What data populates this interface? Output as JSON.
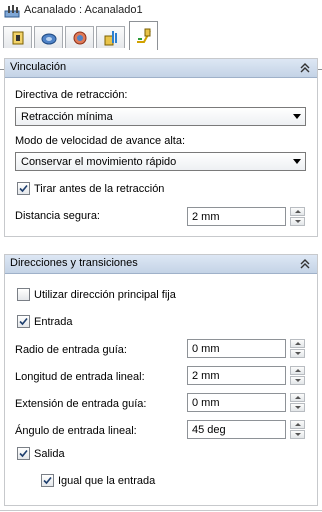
{
  "window": {
    "title": "Acanalado : Acanalado1"
  },
  "tabs": [
    {
      "icon": "strategy-tab-icon",
      "active": false
    },
    {
      "icon": "tool-tab-icon",
      "active": false
    },
    {
      "icon": "stock-tab-icon",
      "active": false
    },
    {
      "icon": "passes-tab-icon",
      "active": false
    },
    {
      "icon": "linking-tab-icon",
      "active": true
    }
  ],
  "vinculacion": {
    "title": "Vinculación",
    "retract_label": "Directiva de retracción:",
    "retract_value": "Retracción mínima",
    "feed_label": "Modo de velocidad de avance alta:",
    "feed_value": "Conservar el movimiento rápido",
    "tilt_label": "Tirar antes de la retracción",
    "tilt_checked": true,
    "safe_label": "Distancia segura:",
    "safe_value": "2 mm"
  },
  "direcciones": {
    "title": "Direcciones y transiciones",
    "main_dir_label": "Utilizar dirección principal fija",
    "main_dir_checked": false,
    "entry_label": "Entrada",
    "entry_checked": true,
    "guide_radius_label": "Radio de entrada guía:",
    "guide_radius_value": "0 mm",
    "linear_length_label": "Longitud de entrada lineal:",
    "linear_length_value": "2 mm",
    "guide_ext_label": "Extensión de entrada guía:",
    "guide_ext_value": "0 mm",
    "linear_angle_label": "Ángulo de entrada lineal:",
    "linear_angle_value": "45 deg",
    "exit_label": "Salida",
    "exit_checked": true,
    "same_label": "Igual que la entrada",
    "same_checked": true
  }
}
